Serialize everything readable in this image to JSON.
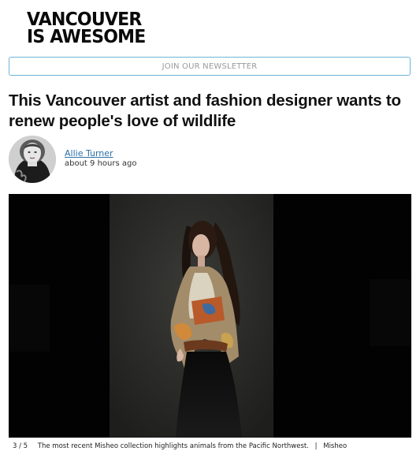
{
  "site": {
    "logo_line1": "VANCOUVER",
    "logo_line2": "IS AWESOME"
  },
  "newsletter": {
    "label": "JOIN OUR NEWSLETTER"
  },
  "article": {
    "headline": "This Vancouver artist and fashion designer wants to renew people's love of wildlife",
    "author": "Allie Turner",
    "published": "about 9 hours ago"
  },
  "gallery": {
    "counter": "3 / 5",
    "caption": "The most recent Misheo collection highlights animals from the Pacific Northwest.",
    "separator": "|",
    "credit": "Misheo"
  },
  "colors": {
    "link": "#2a6fa6",
    "newsletter_border": "#6eb4d8"
  }
}
